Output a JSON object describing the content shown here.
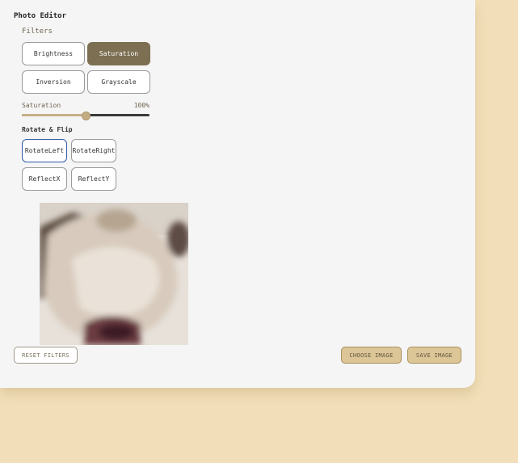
{
  "app": {
    "title": "Photo Editor"
  },
  "filters": {
    "label": "Filters",
    "options": [
      "Brightness",
      "Saturation",
      "Inversion",
      "Grayscale"
    ],
    "active": "Saturation"
  },
  "slider": {
    "label": "Saturation",
    "value_text": "100%",
    "value_fraction": 0.5
  },
  "rotate": {
    "title": "Rotate & Flip",
    "buttons": [
      "RotateLeft",
      "RotateRight",
      "ReflectX",
      "ReflectY"
    ]
  },
  "actions": {
    "reset": "RESET FILTERS",
    "choose": "CHOOSE IMAGE",
    "save": "SAVE IMAGE"
  },
  "colors": {
    "page_background": "#f2dfb9",
    "card_background": "#f5f5f5",
    "active_filter": "#7c6f52",
    "accent_button": "#dcc596",
    "focus_outline": "#2f5aa8"
  }
}
